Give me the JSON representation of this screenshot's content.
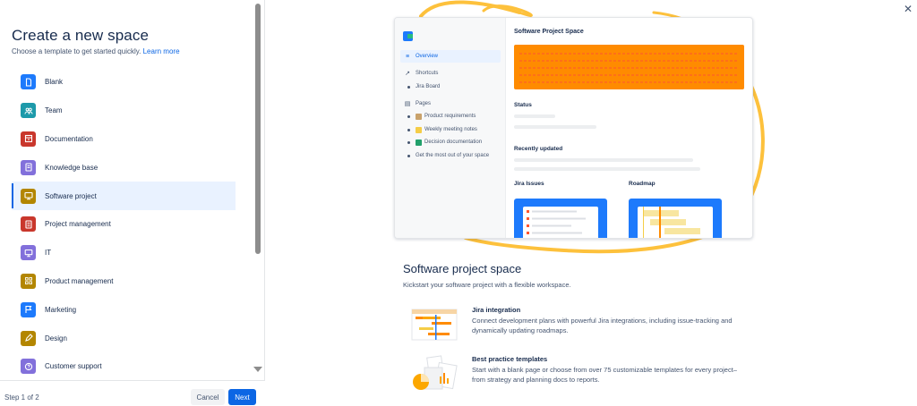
{
  "left_panel": {
    "title": "Create a new space",
    "subtitle": "Choose a template to get started quickly.",
    "learn_more": "Learn more",
    "templates": [
      {
        "label": "Blank",
        "icon": "file-icon",
        "color": "#1d7afc"
      },
      {
        "label": "Team",
        "icon": "people-icon",
        "color": "#1d9aaa"
      },
      {
        "label": "Documentation",
        "icon": "archive-icon",
        "color": "#c9372c"
      },
      {
        "label": "Knowledge base",
        "icon": "book-icon",
        "color": "#8270db"
      },
      {
        "label": "Software project",
        "icon": "monitor-icon",
        "color": "#b38600"
      },
      {
        "label": "Project management",
        "icon": "clipboard-icon",
        "color": "#c9372c"
      },
      {
        "label": "IT",
        "icon": "computer-icon",
        "color": "#8270db"
      },
      {
        "label": "Product management",
        "icon": "grid-icon",
        "color": "#b38600"
      },
      {
        "label": "Marketing",
        "icon": "flag-icon",
        "color": "#1d7afc"
      },
      {
        "label": "Design",
        "icon": "pencil-icon",
        "color": "#b38600"
      },
      {
        "label": "Customer support",
        "icon": "help-icon",
        "color": "#8270db"
      }
    ],
    "selected_template": "Software project"
  },
  "footer": {
    "step": "Step 1 of 2",
    "cancel": "Cancel",
    "next": "Next"
  },
  "preview": {
    "nav": {
      "overview": "Overview",
      "shortcuts": "Shortcuts",
      "jira_board": "Jira Board",
      "pages": "Pages",
      "page_items": [
        "Product requirements",
        "Weekly meeting notes",
        "Decision documentation",
        "Get the most out of your space"
      ]
    },
    "space_title": "Software Project Space",
    "status": "Status",
    "recently_updated": "Recently updated",
    "jira_issues": "Jira Issues",
    "roadmap": "Roadmap"
  },
  "description": {
    "title": "Software project space",
    "subtitle": "Kickstart your software project with a flexible workspace.",
    "features": [
      {
        "title": "Jira integration",
        "text": "Connect development plans with powerful Jira integrations, including issue-tracking and dynamically updating roadmaps."
      },
      {
        "title": "Best practice templates",
        "text": "Start with a blank page or choose from over 75 customizable templates for every project–from strategy and planning docs to reports."
      }
    ]
  },
  "colors": {
    "primary": "#0c66e4",
    "banner": "#ff8b00",
    "swirl": "#fdc13c",
    "selected_bg": "#e9f2ff"
  }
}
